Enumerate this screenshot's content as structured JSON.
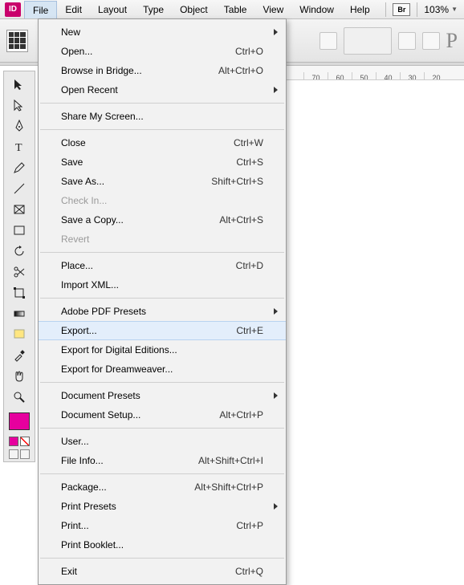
{
  "app": {
    "icon_text": "ID"
  },
  "menubar": {
    "items": [
      "File",
      "Edit",
      "Layout",
      "Type",
      "Object",
      "Table",
      "View",
      "Window",
      "Help"
    ],
    "open_index": 0,
    "br_label": "Br",
    "zoom": "103%"
  },
  "ruler": {
    "ticks": [
      "70",
      "60",
      "50",
      "40",
      "30",
      "20"
    ]
  },
  "file_menu": {
    "groups": [
      [
        {
          "label": "New",
          "submenu": true
        },
        {
          "label": "Open...",
          "shortcut": "Ctrl+O"
        },
        {
          "label": "Browse in Bridge...",
          "shortcut": "Alt+Ctrl+O"
        },
        {
          "label": "Open Recent",
          "submenu": true
        }
      ],
      [
        {
          "label": "Share My Screen..."
        }
      ],
      [
        {
          "label": "Close",
          "shortcut": "Ctrl+W"
        },
        {
          "label": "Save",
          "shortcut": "Ctrl+S"
        },
        {
          "label": "Save As...",
          "shortcut": "Shift+Ctrl+S"
        },
        {
          "label": "Check In...",
          "disabled": true
        },
        {
          "label": "Save a Copy...",
          "shortcut": "Alt+Ctrl+S"
        },
        {
          "label": "Revert",
          "disabled": true
        }
      ],
      [
        {
          "label": "Place...",
          "shortcut": "Ctrl+D"
        },
        {
          "label": "Import XML..."
        }
      ],
      [
        {
          "label": "Adobe PDF Presets",
          "submenu": true
        },
        {
          "label": "Export...",
          "shortcut": "Ctrl+E",
          "highlight": true
        },
        {
          "label": "Export for Digital Editions..."
        },
        {
          "label": "Export for Dreamweaver..."
        }
      ],
      [
        {
          "label": "Document Presets",
          "submenu": true
        },
        {
          "label": "Document Setup...",
          "shortcut": "Alt+Ctrl+P"
        }
      ],
      [
        {
          "label": "User..."
        },
        {
          "label": "File Info...",
          "shortcut": "Alt+Shift+Ctrl+I"
        }
      ],
      [
        {
          "label": "Package...",
          "shortcut": "Alt+Shift+Ctrl+P"
        },
        {
          "label": "Print Presets",
          "submenu": true
        },
        {
          "label": "Print...",
          "shortcut": "Ctrl+P"
        },
        {
          "label": "Print Booklet..."
        }
      ],
      [
        {
          "label": "Exit",
          "shortcut": "Ctrl+Q"
        }
      ]
    ]
  }
}
